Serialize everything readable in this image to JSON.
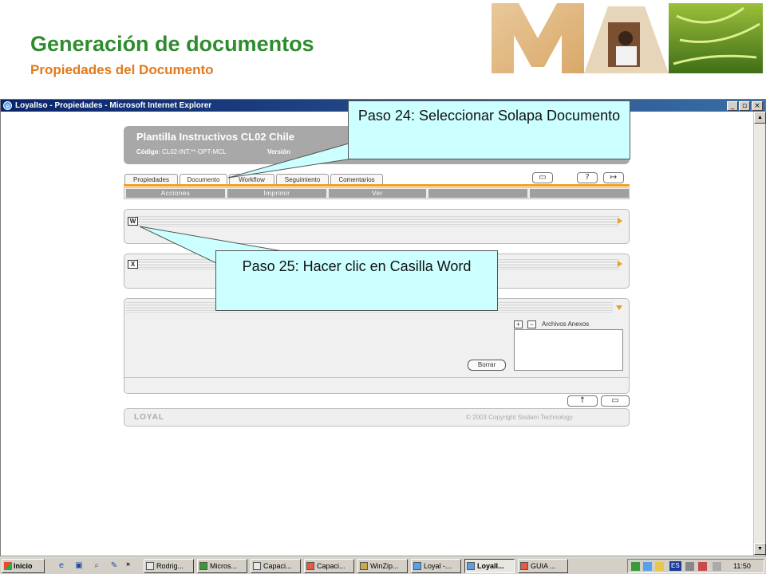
{
  "slide": {
    "title": "Generación de documentos",
    "subtitle": "Propiedades del Documento",
    "logo_text": "MAS"
  },
  "window": {
    "title": "LoyalIso - Propiedades - Microsoft Internet Explorer",
    "minimize": "_",
    "maximize": "▫",
    "close": "×"
  },
  "app": {
    "header_title": "Plantilla Instructivos CL02 Chile",
    "code_label": "Código",
    "code_value": ": CL02-INT.**-OPT-MCL",
    "version_label": "Versión",
    "tabs": [
      "Propiedades",
      "Documento",
      "Workflow",
      "Seguimiento",
      "Comentarios"
    ],
    "toolbar_icons": [
      "save-icon",
      "help-icon",
      "exit-icon"
    ],
    "menu": [
      "Acciones",
      "Imprimir",
      "Ver",
      "",
      ""
    ],
    "word_icon": "W",
    "excel_icon": "X",
    "anexos_label": "Archivos Anexos",
    "add_symbol": "+",
    "remove_symbol": "−",
    "borrar_label": "Borrar",
    "footer_brand": "LOYAL",
    "footer_copyright": "© 2003 Copyright Sisdam Technology",
    "accent_color": "#f0a020"
  },
  "callouts": {
    "step24": "Paso 24: Seleccionar Solapa Documento",
    "step25": "Paso 25: Hacer clic en Casilla Word"
  },
  "taskbar": {
    "start_label": "Inicio",
    "overflow": "»",
    "tasks": [
      "Rodrig...",
      "Micros...",
      "Capaci...",
      "Capaci...",
      "WinZip...",
      "Loyal -...",
      "LoyalI...",
      "GUIA ..."
    ],
    "language": "ES",
    "clock": "11:50"
  }
}
